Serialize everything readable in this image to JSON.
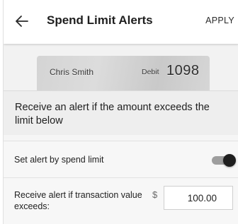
{
  "header": {
    "title": "Spend Limit Alerts",
    "apply_label": "APPLY",
    "back_icon": "arrow-left-icon"
  },
  "card": {
    "holder_name": "Chris Smith",
    "type": "Debit",
    "last_digits": "1098"
  },
  "description": "Receive an alert if the amount exceeds the limit below",
  "toggle_row": {
    "label": "Set alert by spend limit",
    "enabled": true
  },
  "amount_row": {
    "label": "Receive alert if transaction value exceeds:",
    "currency_symbol": "$",
    "value": "100.00"
  },
  "colors": {
    "background": "#f5f5f5",
    "header": "#ffffff",
    "toggle_thumb": "#1f1f1f",
    "toggle_track": "#9e9e9e"
  }
}
